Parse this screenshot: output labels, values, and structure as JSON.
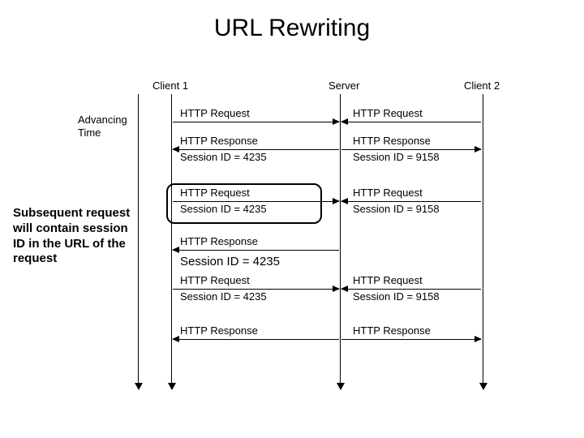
{
  "title": "URL Rewriting",
  "caption": "Subsequent request will contain session ID in the URL of the request",
  "timeAxis": {
    "l1": "Advancing",
    "l2": "Time"
  },
  "actors": {
    "client1": "Client 1",
    "server": "Server",
    "client2": "Client 2"
  },
  "labels": {
    "httpReq": "HTTP Request",
    "httpResp": "HTTP Response",
    "sid4235": "Session ID = 4235",
    "sid9158": "Session ID = 9158",
    "sid4235_big": "Session ID = 4235"
  },
  "chart_data": {
    "type": "sequence-diagram",
    "title": "URL Rewriting",
    "actors": [
      "Client 1",
      "Server",
      "Client 2"
    ],
    "timeAxisLabel": "Advancing Time",
    "annotation": "Subsequent request will contain session ID in the URL of the request",
    "messages": [
      {
        "from": "Client 1",
        "to": "Server",
        "text": "HTTP Request"
      },
      {
        "from": "Client 2",
        "to": "Server",
        "text": "HTTP Request"
      },
      {
        "from": "Server",
        "to": "Client 1",
        "text": "HTTP Response\nSession ID = 4235"
      },
      {
        "from": "Server",
        "to": "Client 2",
        "text": "HTTP Response\nSession ID = 9158"
      },
      {
        "from": "Client 1",
        "to": "Server",
        "text": "HTTP Request\nSession ID = 4235",
        "highlighted": true
      },
      {
        "from": "Client 2",
        "to": "Server",
        "text": "HTTP Request\nSession ID = 9158"
      },
      {
        "from": "Server",
        "to": "Client 1",
        "text": "HTTP Response\nSession ID = 4235"
      },
      {
        "from": "Client 1",
        "to": "Server",
        "text": "HTTP Request\nSession ID = 4235"
      },
      {
        "from": "Client 2",
        "to": "Server",
        "text": "HTTP Request\nSession ID = 9158"
      },
      {
        "from": "Server",
        "to": "Client 1",
        "text": "HTTP Response"
      },
      {
        "from": "Server",
        "to": "Client 2",
        "text": "HTTP Response"
      }
    ]
  }
}
